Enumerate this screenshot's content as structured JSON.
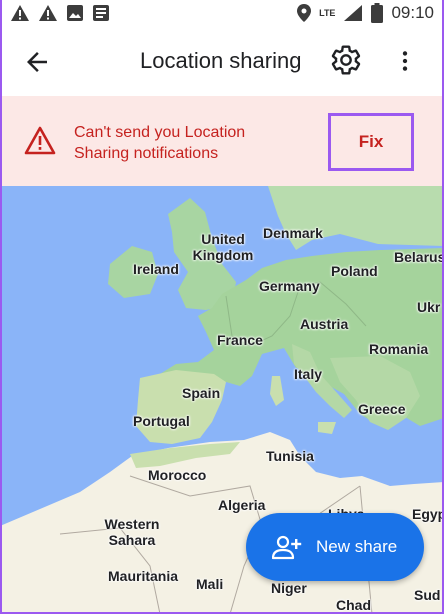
{
  "status_bar": {
    "time": "09:10",
    "network": "LTE",
    "icons": [
      "warning-icon",
      "warning-icon",
      "image-icon",
      "notes-icon",
      "location-pin-icon",
      "signal-icon",
      "battery-icon"
    ]
  },
  "app_bar": {
    "title": "Location sharing",
    "back_icon": "arrow-back-icon",
    "settings_icon": "gear-icon",
    "more_icon": "more-vert-icon"
  },
  "banner": {
    "message": "Can't send you Location Sharing notifications",
    "action_label": "Fix",
    "colors": {
      "background": "#fce8e6",
      "text": "#c5221f"
    }
  },
  "map": {
    "labels": {
      "denmark": "Denmark",
      "united_kingdom": "United Kingdom",
      "ireland": "Ireland",
      "belarus": "Belarus",
      "poland": "Poland",
      "germany": "Germany",
      "ukraine": "Ukr",
      "austria": "Austria",
      "france": "France",
      "romania": "Romania",
      "italy": "Italy",
      "spain": "Spain",
      "portugal": "Portugal",
      "greece": "Greece",
      "tunisia": "Tunisia",
      "morocco": "Morocco",
      "algeria": "Algeria",
      "libya": "Libya",
      "egypt": "Egyp",
      "western_sahara": "Western Sahara",
      "mauritania": "Mauritania",
      "mali": "Mali",
      "niger": "Niger",
      "chad": "Chad",
      "sudan": "Sud"
    }
  },
  "fab": {
    "label": "New share",
    "icon": "person-add-icon",
    "color": "#1a73e8"
  }
}
